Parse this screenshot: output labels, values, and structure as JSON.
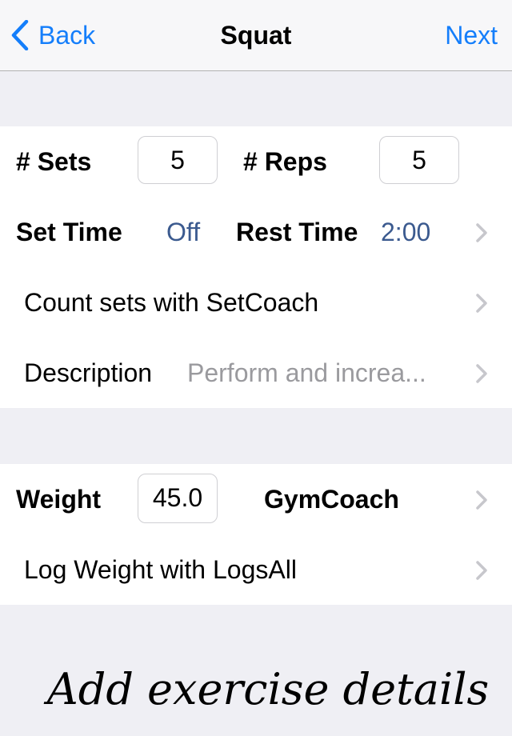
{
  "navbar": {
    "back_label": "Back",
    "title": "Squat",
    "next_label": "Next",
    "accent_color": "#147efb"
  },
  "section1": {
    "sets_label": "# Sets",
    "sets_value": "5",
    "reps_label": "# Reps",
    "reps_value": "5",
    "set_time_label": "Set Time",
    "set_time_value": "Off",
    "rest_time_label": "Rest Time",
    "rest_time_value": "2:00",
    "count_sets_label": "Count sets with SetCoach",
    "description_label": "Description",
    "description_value": "Perform  and increa..."
  },
  "section2": {
    "weight_label": "Weight",
    "weight_value": "45.0",
    "gymcoach_label": "GymCoach",
    "log_weight_label": "Log Weight with LogsAll"
  },
  "caption": "Add exercise details"
}
